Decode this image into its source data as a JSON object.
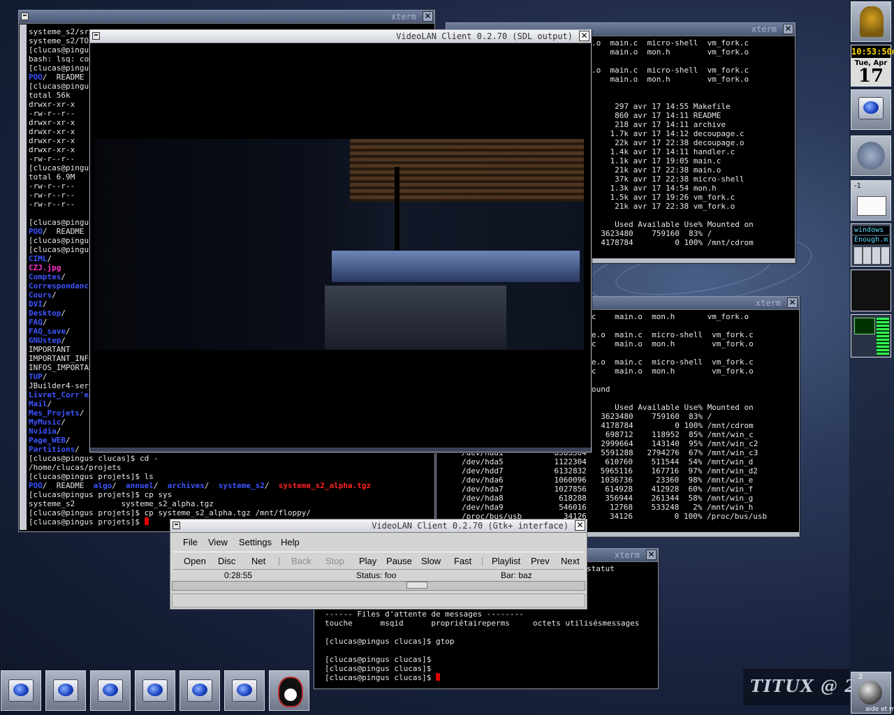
{
  "xterm_main": {
    "lines": [
      [
        {
          "t": "systeme_s2/src"
        }
      ],
      [
        {
          "t": "systeme_s2/TOI"
        }
      ],
      [
        {
          "t": "[clucas@pingus"
        }
      ],
      [
        {
          "t": "bash: lsq: com"
        }
      ],
      [
        {
          "t": "[clucas@pingus"
        }
      ],
      [
        {
          "t": "POO",
          "c": "blue"
        },
        {
          "t": "/  README"
        }
      ],
      [
        {
          "t": "[clucas@pingus"
        }
      ],
      [
        {
          "t": "total 56k"
        }
      ],
      [
        {
          "t": "drwxr-xr-x"
        }
      ],
      [
        {
          "t": "-rw-r--r--"
        }
      ],
      [
        {
          "t": "drwxr-xr-x"
        }
      ],
      [
        {
          "t": "drwxr-xr-x"
        }
      ],
      [
        {
          "t": "drwxr-xr-x"
        }
      ],
      [
        {
          "t": "drwxr-xr-x"
        }
      ],
      [
        {
          "t": "-rw-r--r--"
        }
      ],
      [
        {
          "t": "[clucas@pingus"
        }
      ],
      [
        {
          "t": "total 6.9M"
        }
      ],
      [
        {
          "t": "-rw-r--r--"
        }
      ],
      [
        {
          "t": "-rw-r--r--"
        }
      ],
      [
        {
          "t": "-rw-r--r--"
        }
      ],
      [
        {
          "t": ""
        }
      ],
      [
        {
          "t": "[clucas@pingus"
        }
      ],
      [
        {
          "t": "POO",
          "c": "blue"
        },
        {
          "t": "/  README"
        }
      ],
      [
        {
          "t": "[clucas@pingus"
        }
      ],
      [
        {
          "t": "[clucas@pingus"
        }
      ],
      [
        {
          "t": "CIML",
          "c": "blue"
        },
        {
          "t": "/"
        }
      ],
      [
        {
          "t": "CZJ.jpg",
          "c": "mag"
        }
      ],
      [
        {
          "t": "Comptes",
          "c": "blue"
        },
        {
          "t": "/"
        }
      ],
      [
        {
          "t": "Correspondance",
          "c": "blue"
        }
      ],
      [
        {
          "t": "Cours",
          "c": "blue"
        },
        {
          "t": "/"
        }
      ],
      [
        {
          "t": "DVI",
          "c": "blue"
        },
        {
          "t": "/"
        }
      ],
      [
        {
          "t": "Desktop",
          "c": "blue"
        },
        {
          "t": "/"
        }
      ],
      [
        {
          "t": "FAQ",
          "c": "blue"
        },
        {
          "t": "/"
        }
      ],
      [
        {
          "t": "FAQ_save",
          "c": "blue"
        },
        {
          "t": "/"
        }
      ],
      [
        {
          "t": "GNUstep",
          "c": "blue"
        },
        {
          "t": "/"
        }
      ],
      [
        {
          "t": "IMPORTANT"
        }
      ],
      [
        {
          "t": "IMPORTANT_INFO"
        }
      ],
      [
        {
          "t": "INFOS_IMPORTAN"
        }
      ],
      [
        {
          "t": "TUP",
          "c": "blue"
        },
        {
          "t": "/"
        }
      ],
      [
        {
          "t": "JBuilder4-seri"
        }
      ],
      [
        {
          "t": "Livret_Corr'e",
          "c": "blue"
        },
        {
          "t": "/"
        }
      ],
      [
        {
          "t": "Mail",
          "c": "blue"
        },
        {
          "t": "/"
        }
      ],
      [
        {
          "t": "Mes_Projets",
          "c": "blue"
        },
        {
          "t": "/"
        }
      ],
      [
        {
          "t": "MyMusic",
          "c": "blue"
        },
        {
          "t": "/"
        }
      ],
      [
        {
          "t": "Nvidia",
          "c": "blue"
        },
        {
          "t": "/"
        }
      ],
      [
        {
          "t": "Page_WEB",
          "c": "blue"
        },
        {
          "t": "/"
        }
      ],
      [
        {
          "t": "Partitions",
          "c": "blue"
        },
        {
          "t": "/"
        }
      ],
      [
        {
          "t": "[clucas@pingus clucas]$ cd -"
        }
      ],
      [
        {
          "t": "/home/clucas/projets"
        }
      ],
      [
        {
          "t": "[clucas@pingus projets]$ ls"
        }
      ],
      [
        {
          "t": "POO",
          "c": "blue"
        },
        {
          "t": "/  README  "
        },
        {
          "t": "algo",
          "c": "blue"
        },
        {
          "t": "/  "
        },
        {
          "t": "annuel",
          "c": "blue"
        },
        {
          "t": "/  "
        },
        {
          "t": "archives",
          "c": "blue"
        },
        {
          "t": "/  "
        },
        {
          "t": "systeme_s2",
          "c": "blue"
        },
        {
          "t": "/  "
        },
        {
          "t": "systeme_s2_alpha.tgz",
          "c": "red"
        }
      ],
      [
        {
          "t": "[clucas@pingus projets]$ cp sys"
        }
      ],
      [
        {
          "t": "systeme_s2          systeme_s2_alpha.tgz"
        }
      ],
      [
        {
          "t": "[clucas@pingus projets]$ cp systeme_s2_alpha.tgz /mnt/floppy/"
        }
      ],
      [
        {
          "t": "[clucas@pingus projets]$ "
        },
        {
          "t": "",
          "c": "cursor"
        }
      ]
    ]
  },
  "xterm_topright": {
    "title": "xterm",
    "lines": [
      [
        {
          "t": ".o  main.c  micro-shell  vm_fork.c"
        }
      ],
      [
        {
          "t": "    main.o  mon.h        vm_fork.o"
        }
      ],
      [
        {
          "t": ""
        }
      ],
      [
        {
          "t": ".o  main.c  micro-shell  vm_fork.c"
        }
      ],
      [
        {
          "t": "    main.o  mon.h        vm_fork.o"
        }
      ],
      [
        {
          "t": ""
        }
      ],
      [
        {
          "t": ""
        }
      ],
      [
        {
          "t": "     297 avr 17 14:55 Makefile"
        }
      ],
      [
        {
          "t": "     860 avr 17 14:11 README"
        }
      ],
      [
        {
          "t": "     218 avr 17 14:11 archive"
        }
      ],
      [
        {
          "t": "    1.7k avr 17 14:12 decoupage.c"
        }
      ],
      [
        {
          "t": "     22k avr 17 22:38 decoupage.o"
        }
      ],
      [
        {
          "t": "    1.4k avr 17 14:11 handler.c"
        }
      ],
      [
        {
          "t": "    1.1k avr 17 19:05 main.c"
        }
      ],
      [
        {
          "t": "     21k avr 17 22:38 main.o"
        }
      ],
      [
        {
          "t": "     37k avr 17 22:38 micro-shell"
        }
      ],
      [
        {
          "t": "    1.3k avr 17 14:54 mon.h"
        }
      ],
      [
        {
          "t": "    1.5k avr 17 19:26 vm_fork.c"
        }
      ],
      [
        {
          "t": "     21k avr 17 22:38 vm_fork.o"
        }
      ],
      [
        {
          "t": ""
        }
      ],
      [
        {
          "t": "     Used Available Use% Mounted on"
        }
      ],
      [
        {
          "t": "  3623480    759160  83% /"
        }
      ],
      [
        {
          "t": "  4178784         0 100% /mnt/cdrom"
        }
      ]
    ]
  },
  "xterm_midright": {
    "title": "xterm",
    "lines": [
      [
        {
          "t": "c    main.o  mon.h       vm_fork.o"
        }
      ],
      [
        {
          "t": ""
        }
      ],
      [
        {
          "t": "e.o  main.c  micro-shell  vm_fork.c"
        }
      ],
      [
        {
          "t": "c    main.o  mon.h        vm_fork.o"
        }
      ],
      [
        {
          "t": ""
        }
      ],
      [
        {
          "t": "e.o  main.c  micro-shell  vm_fork.c"
        }
      ],
      [
        {
          "t": "c    main.o  mon.h        vm_fork.o"
        }
      ],
      [
        {
          "t": ""
        }
      ],
      [
        {
          "t": "ound"
        }
      ],
      [
        {
          "t": ""
        }
      ],
      [
        {
          "t": "     Used Available Use% Mounted on"
        }
      ],
      [
        {
          "t": "  3623480    759160  83% /"
        }
      ],
      [
        {
          "t": "  4178784         0 100% /mnt/cdrom"
        }
      ],
      [
        {
          "t": "   698712    118952  85% /mnt/win_c"
        }
      ],
      [
        {
          "t": "  2999664    143140  95% /mnt/win_c2"
        }
      ],
      [
        {
          "t": "  5591288   2794276  67% /mnt/win_c3"
        }
      ]
    ],
    "df_rows": [
      "/dev/hdd1           8583304",
      "/dev/hda5           1122304    610760    511544  54% /mnt/win_d",
      "/dev/hdd7           6132832   5965116    167716  97% /mnt/win_d2",
      "/dev/hda6           1060096   1036736     23360  98% /mnt/win_e",
      "/dev/hda7           1027856    614928    412928  60% /mnt/win_f",
      "/dev/hda8            618288    356944    261344  58% /mnt/win_g",
      "/dev/hda9            546016     12768    533248   2% /mnt/win_h",
      "/proc/bus/usb         34126     34126         0 100% /proc/bus/usb"
    ]
  },
  "xterm_bottom": {
    "title": "xterm",
    "lines": [
      [
        {
          "t": "statut"
        }
      ]
    ],
    "lines2": [
      [
        {
          "t": "------ Files d'attente de messages --------"
        }
      ],
      [
        {
          "t": "touche      msqid      propriétaireperms     octets utilisésmessages"
        }
      ],
      [
        {
          "t": ""
        }
      ],
      [
        {
          "t": "[clucas@pingus clucas]$ gtop"
        }
      ],
      [
        {
          "t": ""
        }
      ],
      [
        {
          "t": "[clucas@pingus clucas]$"
        }
      ],
      [
        {
          "t": "[clucas@pingus clucas]$"
        }
      ],
      [
        {
          "t": "[clucas@pingus clucas]$ "
        },
        {
          "t": "",
          "c": "cursor"
        }
      ]
    ]
  },
  "vlc_sdl": {
    "title": "VideoLAN Client 0.2.70 (SDL output)",
    "close": "✕"
  },
  "vlc_gtk": {
    "title": "VideoLAN Client 0.2.70 (Gtk+ interface)",
    "menu": [
      "File",
      "View",
      "Settings",
      "Help"
    ],
    "toolbar": {
      "open": "Open",
      "disc": "Disc",
      "net": "Net",
      "back": "Back",
      "stop": "Stop",
      "play": "Play",
      "pause": "Pause",
      "slow": "Slow",
      "fast": "Fast",
      "playlist": "Playlist",
      "prev": "Prev",
      "next": "Next"
    },
    "status": {
      "time": "0:28:55",
      "status": "Status: foo",
      "bar": "Bar: baz"
    },
    "progress": 0.6
  },
  "dock": {
    "clock_time": "10:53:50",
    "clock_suffix": "P",
    "date_day": "Tue, Apr",
    "date_num": "17",
    "mail_count": "-1",
    "wm_line1": "windows",
    "wm_line2": "Enough.m"
  },
  "branding": {
    "text": "TITUX @ 2",
    "corner_label": "aide et m",
    "corner_num": "2"
  },
  "colors": {
    "dir": "#3c55ff",
    "image": "#ff33cc",
    "archive": "#ff2222",
    "prompt_cursor": "#e00000"
  }
}
